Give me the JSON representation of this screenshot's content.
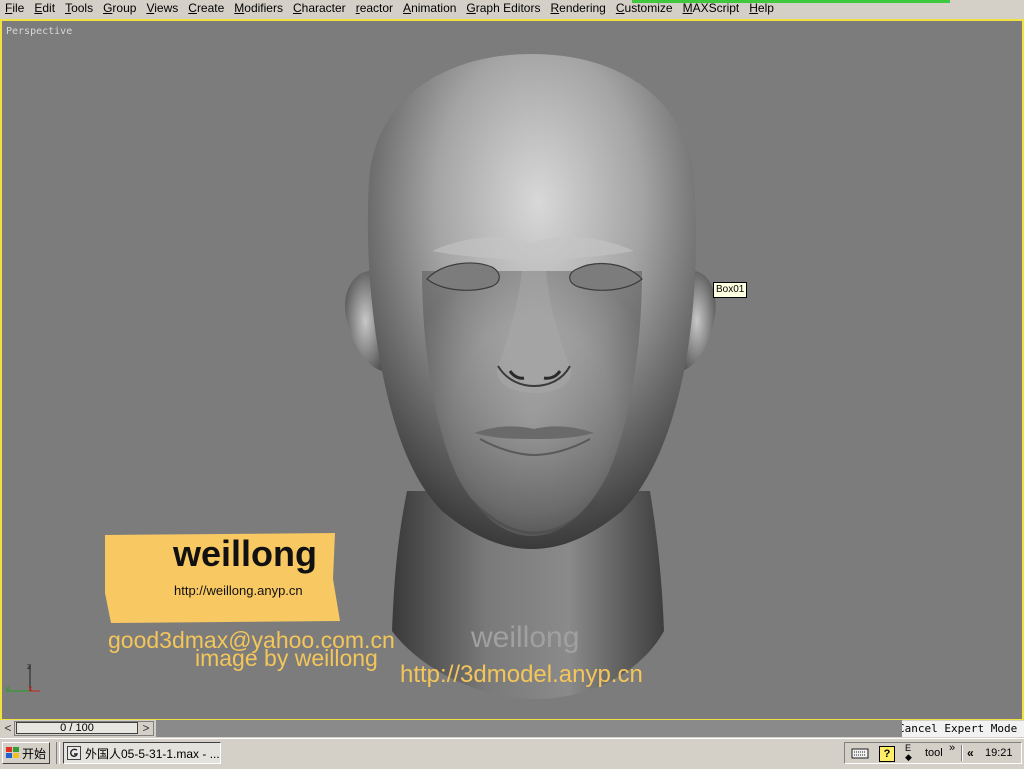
{
  "menu": {
    "items": [
      {
        "label": "File",
        "key": "file"
      },
      {
        "label": "Edit",
        "key": "edit"
      },
      {
        "label": "Tools",
        "key": "tools"
      },
      {
        "label": "Group",
        "key": "group"
      },
      {
        "label": "Views",
        "key": "views"
      },
      {
        "label": "Create",
        "key": "create"
      },
      {
        "label": "Modifiers",
        "key": "modifiers"
      },
      {
        "label": "Character",
        "key": "character"
      },
      {
        "label": "reactor",
        "key": "reactor"
      },
      {
        "label": "Animation",
        "key": "animation"
      },
      {
        "label": "Graph Editors",
        "key": "graph-editors"
      },
      {
        "label": "Rendering",
        "key": "rendering"
      },
      {
        "label": "Customize",
        "key": "customize"
      },
      {
        "label": "MAXScript",
        "key": "maxscript"
      },
      {
        "label": "Help",
        "key": "help"
      }
    ]
  },
  "viewport": {
    "label": "Perspective",
    "tooltip": "Box01",
    "border_color": "#f0e040",
    "background": "#7c7c7c",
    "axis": {
      "z": "z",
      "x": "x",
      "y": "y"
    }
  },
  "watermarks": {
    "brand": "weillong",
    "brand_url": "http://weillong.anyp.cn",
    "email": "good3dmax@yahoo.com.cn",
    "byline": "image by weillong",
    "center": "weillong",
    "model_url": "http://3dmodel.anyp.cn"
  },
  "timeline": {
    "frame_display": "0 / 100",
    "prev_arrow": "<",
    "next_arrow": ">",
    "expert_mode_text": "Cancel Expert Mode"
  },
  "taskbar": {
    "start_label": "开始",
    "task_title": "外国人05-5-31-1.max - ...",
    "tray": {
      "help": "?",
      "ime": "E\n◆",
      "tool_label": "tool",
      "chevron": "»",
      "arrows": "«",
      "clock": "19:21"
    }
  }
}
